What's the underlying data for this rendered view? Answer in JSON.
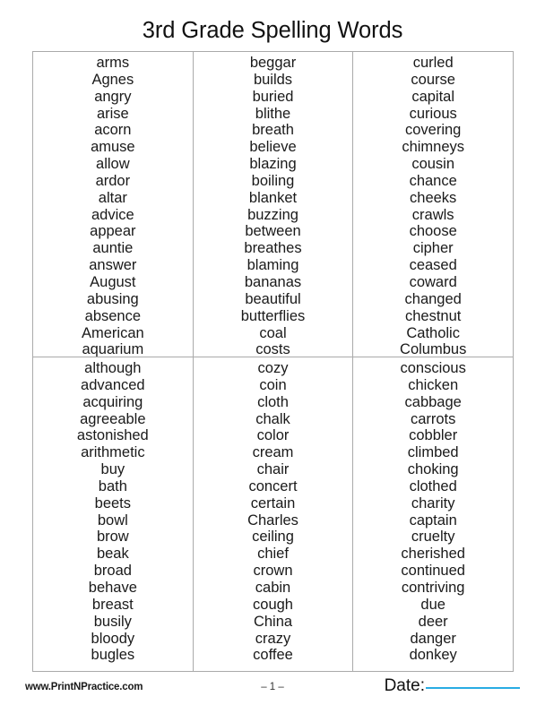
{
  "title": "3rd Grade Spelling Words",
  "colors": {
    "table_border": "#aaaaaa",
    "text": "#1a1a1a",
    "date_line": "#29ace3"
  },
  "table": {
    "groups": [
      {
        "columns": [
          {
            "words": [
              "arms",
              "Agnes",
              "angry",
              "arise",
              "acorn",
              "amuse",
              "allow",
              "ardor",
              "altar",
              "advice",
              "appear",
              "auntie",
              "answer",
              "August",
              "abusing",
              "absence",
              "American",
              "aquarium"
            ]
          },
          {
            "words": [
              "beggar",
              "builds",
              "buried",
              "blithe",
              "breath",
              "believe",
              "blazing",
              "boiling",
              "blanket",
              "buzzing",
              "between",
              "breathes",
              "blaming",
              "bananas",
              "beautiful",
              "butterflies",
              "coal",
              "costs"
            ]
          },
          {
            "words": [
              "curled",
              "course",
              "capital",
              "curious",
              "covering",
              "chimneys",
              "cousin",
              "chance",
              "cheeks",
              "crawls",
              "choose",
              "cipher",
              "ceased",
              "coward",
              "changed",
              "chestnut",
              "Catholic",
              "Columbus"
            ]
          }
        ]
      },
      {
        "columns": [
          {
            "words": [
              "although",
              "advanced",
              "acquiring",
              "agreeable",
              "astonished",
              "arithmetic",
              "buy",
              "bath",
              "beets",
              "bowl",
              "brow",
              "beak",
              "broad",
              "behave",
              "breast",
              "busily",
              "bloody",
              "bugles"
            ]
          },
          {
            "words": [
              "cozy",
              "coin",
              "cloth",
              "chalk",
              "color",
              "cream",
              "chair",
              "concert",
              "certain",
              "Charles",
              "ceiling",
              "chief",
              "crown",
              "cabin",
              "cough",
              "China",
              "crazy",
              "coffee"
            ]
          },
          {
            "words": [
              "conscious",
              "chicken",
              "cabbage",
              "carrots",
              "cobbler",
              "climbed",
              "choking",
              "clothed",
              "charity",
              "captain",
              "cruelty",
              "cherished",
              "continued",
              "contriving",
              "due",
              "deer",
              "danger",
              "donkey"
            ]
          }
        ]
      }
    ]
  },
  "footer": {
    "url": "www.PrintNPractice.com",
    "page_number": "– 1 –",
    "date_label": "Date:"
  }
}
